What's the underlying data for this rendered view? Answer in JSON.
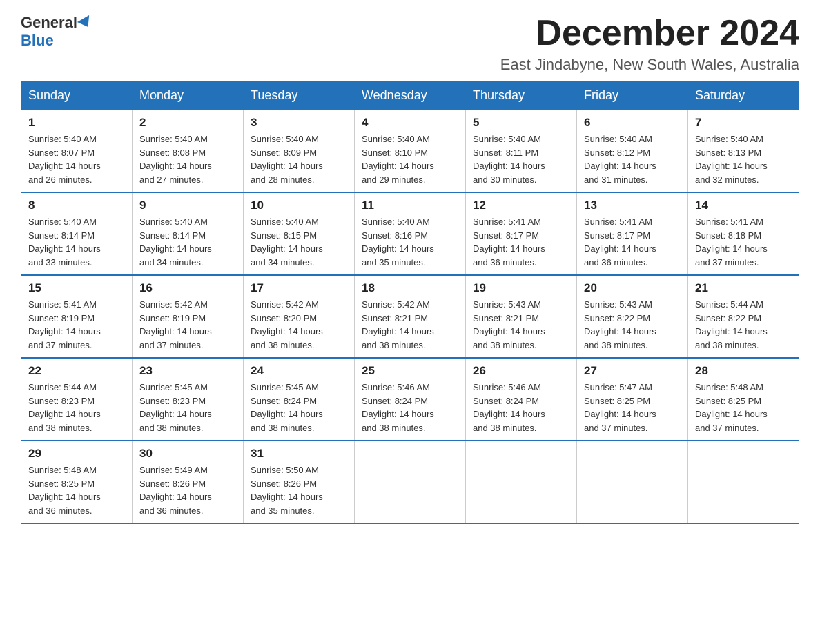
{
  "logo": {
    "general": "General",
    "blue": "Blue"
  },
  "title": "December 2024",
  "location": "East Jindabyne, New South Wales, Australia",
  "days_of_week": [
    "Sunday",
    "Monday",
    "Tuesday",
    "Wednesday",
    "Thursday",
    "Friday",
    "Saturday"
  ],
  "weeks": [
    [
      {
        "day": "1",
        "sunrise": "5:40 AM",
        "sunset": "8:07 PM",
        "daylight": "14 hours and 26 minutes."
      },
      {
        "day": "2",
        "sunrise": "5:40 AM",
        "sunset": "8:08 PM",
        "daylight": "14 hours and 27 minutes."
      },
      {
        "day": "3",
        "sunrise": "5:40 AM",
        "sunset": "8:09 PM",
        "daylight": "14 hours and 28 minutes."
      },
      {
        "day": "4",
        "sunrise": "5:40 AM",
        "sunset": "8:10 PM",
        "daylight": "14 hours and 29 minutes."
      },
      {
        "day": "5",
        "sunrise": "5:40 AM",
        "sunset": "8:11 PM",
        "daylight": "14 hours and 30 minutes."
      },
      {
        "day": "6",
        "sunrise": "5:40 AM",
        "sunset": "8:12 PM",
        "daylight": "14 hours and 31 minutes."
      },
      {
        "day": "7",
        "sunrise": "5:40 AM",
        "sunset": "8:13 PM",
        "daylight": "14 hours and 32 minutes."
      }
    ],
    [
      {
        "day": "8",
        "sunrise": "5:40 AM",
        "sunset": "8:14 PM",
        "daylight": "14 hours and 33 minutes."
      },
      {
        "day": "9",
        "sunrise": "5:40 AM",
        "sunset": "8:14 PM",
        "daylight": "14 hours and 34 minutes."
      },
      {
        "day": "10",
        "sunrise": "5:40 AM",
        "sunset": "8:15 PM",
        "daylight": "14 hours and 34 minutes."
      },
      {
        "day": "11",
        "sunrise": "5:40 AM",
        "sunset": "8:16 PM",
        "daylight": "14 hours and 35 minutes."
      },
      {
        "day": "12",
        "sunrise": "5:41 AM",
        "sunset": "8:17 PM",
        "daylight": "14 hours and 36 minutes."
      },
      {
        "day": "13",
        "sunrise": "5:41 AM",
        "sunset": "8:17 PM",
        "daylight": "14 hours and 36 minutes."
      },
      {
        "day": "14",
        "sunrise": "5:41 AM",
        "sunset": "8:18 PM",
        "daylight": "14 hours and 37 minutes."
      }
    ],
    [
      {
        "day": "15",
        "sunrise": "5:41 AM",
        "sunset": "8:19 PM",
        "daylight": "14 hours and 37 minutes."
      },
      {
        "day": "16",
        "sunrise": "5:42 AM",
        "sunset": "8:19 PM",
        "daylight": "14 hours and 37 minutes."
      },
      {
        "day": "17",
        "sunrise": "5:42 AM",
        "sunset": "8:20 PM",
        "daylight": "14 hours and 38 minutes."
      },
      {
        "day": "18",
        "sunrise": "5:42 AM",
        "sunset": "8:21 PM",
        "daylight": "14 hours and 38 minutes."
      },
      {
        "day": "19",
        "sunrise": "5:43 AM",
        "sunset": "8:21 PM",
        "daylight": "14 hours and 38 minutes."
      },
      {
        "day": "20",
        "sunrise": "5:43 AM",
        "sunset": "8:22 PM",
        "daylight": "14 hours and 38 minutes."
      },
      {
        "day": "21",
        "sunrise": "5:44 AM",
        "sunset": "8:22 PM",
        "daylight": "14 hours and 38 minutes."
      }
    ],
    [
      {
        "day": "22",
        "sunrise": "5:44 AM",
        "sunset": "8:23 PM",
        "daylight": "14 hours and 38 minutes."
      },
      {
        "day": "23",
        "sunrise": "5:45 AM",
        "sunset": "8:23 PM",
        "daylight": "14 hours and 38 minutes."
      },
      {
        "day": "24",
        "sunrise": "5:45 AM",
        "sunset": "8:24 PM",
        "daylight": "14 hours and 38 minutes."
      },
      {
        "day": "25",
        "sunrise": "5:46 AM",
        "sunset": "8:24 PM",
        "daylight": "14 hours and 38 minutes."
      },
      {
        "day": "26",
        "sunrise": "5:46 AM",
        "sunset": "8:24 PM",
        "daylight": "14 hours and 38 minutes."
      },
      {
        "day": "27",
        "sunrise": "5:47 AM",
        "sunset": "8:25 PM",
        "daylight": "14 hours and 37 minutes."
      },
      {
        "day": "28",
        "sunrise": "5:48 AM",
        "sunset": "8:25 PM",
        "daylight": "14 hours and 37 minutes."
      }
    ],
    [
      {
        "day": "29",
        "sunrise": "5:48 AM",
        "sunset": "8:25 PM",
        "daylight": "14 hours and 36 minutes."
      },
      {
        "day": "30",
        "sunrise": "5:49 AM",
        "sunset": "8:26 PM",
        "daylight": "14 hours and 36 minutes."
      },
      {
        "day": "31",
        "sunrise": "5:50 AM",
        "sunset": "8:26 PM",
        "daylight": "14 hours and 35 minutes."
      },
      null,
      null,
      null,
      null
    ]
  ],
  "labels": {
    "sunrise": "Sunrise:",
    "sunset": "Sunset:",
    "daylight": "Daylight:"
  }
}
